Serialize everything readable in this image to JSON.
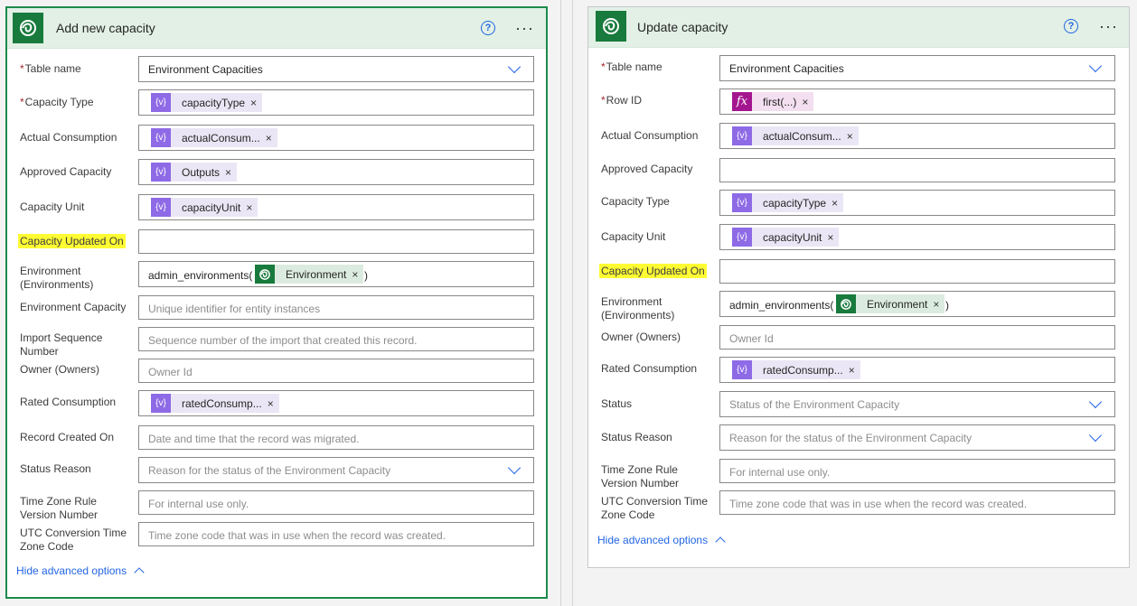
{
  "colors": {
    "accent": "#2266e3",
    "brand": "#187a3c",
    "highlight": "#fffc33",
    "token": "#8e6ae6",
    "fx": "#a4168f"
  },
  "left": {
    "title": "Add new capacity",
    "help": "?",
    "more": "···",
    "hide_link": "Hide advanced options",
    "fields": {
      "table_name": {
        "label": "Table name",
        "value": "Environment Capacities"
      },
      "capacity_type": {
        "label": "Capacity Type",
        "token": "capacityType"
      },
      "actual_consumption": {
        "label": "Actual Consumption",
        "token": "actualConsum..."
      },
      "approved_capacity": {
        "label": "Approved Capacity",
        "token": "Outputs"
      },
      "capacity_unit": {
        "label": "Capacity Unit",
        "token": "capacityUnit"
      },
      "capacity_updated_on": {
        "label": "Capacity Updated On"
      },
      "environment": {
        "label": "Environment (Environments)",
        "prefix": "admin_environments(",
        "token": "Environment",
        "suffix": ")"
      },
      "environment_capacity": {
        "label": "Environment Capacity",
        "placeholder": "Unique identifier for entity instances"
      },
      "import_sequence": {
        "label": "Import Sequence Number",
        "placeholder": "Sequence number of the import that created this record."
      },
      "owner": {
        "label": "Owner (Owners)",
        "placeholder": "Owner Id"
      },
      "rated_consumption": {
        "label": "Rated Consumption",
        "token": "ratedConsump..."
      },
      "record_created_on": {
        "label": "Record Created On",
        "placeholder": "Date and time that the record was migrated."
      },
      "status_reason": {
        "label": "Status Reason",
        "placeholder": "Reason for the status of the Environment Capacity"
      },
      "time_zone_rule": {
        "label": "Time Zone Rule Version Number",
        "placeholder": "For internal use only."
      },
      "utc_conversion": {
        "label": "UTC Conversion Time Zone Code",
        "placeholder": "Time zone code that was in use when the record was created."
      }
    }
  },
  "right": {
    "title": "Update capacity",
    "help": "?",
    "more": "···",
    "hide_link": "Hide advanced options",
    "fields": {
      "table_name": {
        "label": "Table name",
        "value": "Environment Capacities"
      },
      "row_id": {
        "label": "Row ID",
        "token": "first(...)"
      },
      "actual_consumption": {
        "label": "Actual Consumption",
        "token": "actualConsum..."
      },
      "approved_capacity": {
        "label": "Approved Capacity"
      },
      "capacity_type": {
        "label": "Capacity Type",
        "token": "capacityType"
      },
      "capacity_unit": {
        "label": "Capacity Unit",
        "token": "capacityUnit"
      },
      "capacity_updated_on": {
        "label": "Capacity Updated On"
      },
      "environment": {
        "label": "Environment (Environments)",
        "prefix": "admin_environments(",
        "token": "Environment",
        "suffix": ")"
      },
      "owner": {
        "label": "Owner (Owners)",
        "placeholder": "Owner Id"
      },
      "rated_consumption": {
        "label": "Rated Consumption",
        "token": "ratedConsump..."
      },
      "status": {
        "label": "Status",
        "placeholder": "Status of the Environment Capacity"
      },
      "status_reason": {
        "label": "Status Reason",
        "placeholder": "Reason for the status of the Environment Capacity"
      },
      "time_zone_rule": {
        "label": "Time Zone Rule Version Number",
        "placeholder": "For internal use only."
      },
      "utc_conversion": {
        "label": "UTC Conversion Time Zone Code",
        "placeholder": "Time zone code that was in use when the record was created."
      }
    }
  },
  "icons": {
    "variable": "{v}",
    "fx": "fx",
    "close": "×"
  }
}
